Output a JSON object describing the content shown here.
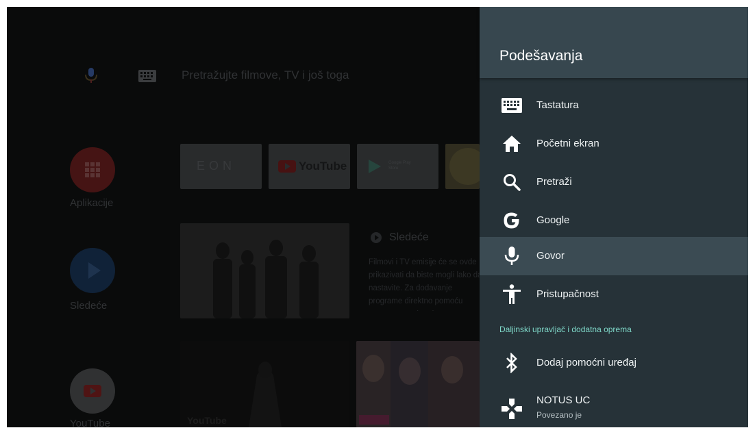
{
  "home": {
    "search_placeholder": "Pretražujte filmove, TV i još toga",
    "rail": [
      {
        "label": "Aplikacije",
        "icon": "apps-grid-icon",
        "color": "#c62828"
      },
      {
        "label": "Sledeće",
        "icon": "play-icon",
        "color": "#1565c0"
      },
      {
        "label": "YouTube",
        "icon": "youtube-icon",
        "color": "#e0e0e0"
      }
    ],
    "apps": [
      {
        "name": "EON",
        "label": "EON"
      },
      {
        "name": "YouTube",
        "label": "YouTube"
      },
      {
        "name": "Google Play Store",
        "label": "Google Play\nStore"
      }
    ],
    "next": {
      "title": "Sledeće",
      "description": "Filmovi i TV emisije će se ovde prikazivati da biste mogli lako da nastavite. Za dodavanje programe direktno pomoću tastera centralno dugme na daljinskom"
    },
    "bottom_label": "YouTube"
  },
  "settings": {
    "title": "Podešavanja",
    "items": [
      {
        "label": "Tastatura",
        "icon": "keyboard-icon"
      },
      {
        "label": "Početni ekran",
        "icon": "home-icon"
      },
      {
        "label": "Pretraži",
        "icon": "search-icon"
      },
      {
        "label": "Google",
        "icon": "google-icon"
      },
      {
        "label": "Govor",
        "icon": "mic-icon",
        "selected": true
      },
      {
        "label": "Pristupačnost",
        "icon": "accessibility-icon"
      }
    ],
    "section_label": "Daljinski upravljač i dodatna oprema",
    "accessory_items": [
      {
        "label": "Dodaj pomoćni uređaj",
        "icon": "bluetooth-icon"
      },
      {
        "label": "NOTUS UC",
        "sublabel": "Povezano je",
        "icon": "gamepad-icon"
      }
    ]
  },
  "colors": {
    "panel_bg": "#263238",
    "header_bg": "#37474f",
    "selected_bg": "#3b4b53",
    "section_accent": "#7fd8c9"
  }
}
